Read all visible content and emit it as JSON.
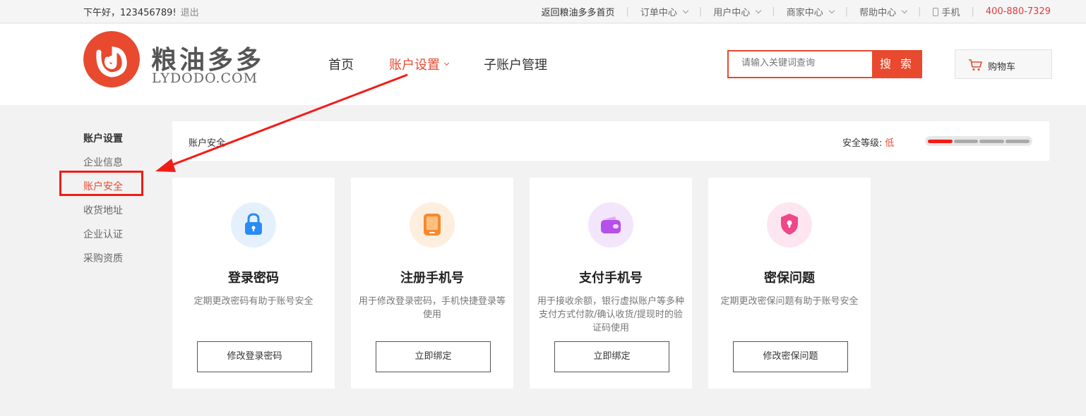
{
  "topbar": {
    "greeting": "下午好，123456789!",
    "logout": "退出",
    "links": [
      {
        "label": "返回粮油多多首页"
      },
      {
        "label": "订单中心"
      },
      {
        "label": "用户中心"
      },
      {
        "label": "商家中心"
      },
      {
        "label": "帮助中心"
      },
      {
        "label": "手机"
      }
    ],
    "hotline": "400-880-7329"
  },
  "header": {
    "logo_cn": "粮油多多",
    "logo_en": "LYDODO.COM",
    "nav": [
      {
        "label": "首页"
      },
      {
        "label": "账户设置"
      },
      {
        "label": "子账户管理"
      }
    ],
    "search_placeholder": "请输入关键词查询",
    "search_button": "搜 索",
    "cart_label": "购物车"
  },
  "sidebar": {
    "title": "账户设置",
    "items": [
      "企业信息",
      "账户安全",
      "收货地址",
      "企业认证",
      "采购资质"
    ]
  },
  "main": {
    "breadcrumb": "账户安全",
    "security_level_label": "安全等级:",
    "security_level_value": "低",
    "security_level_segments_filled": 1,
    "security_level_segments_total": 4,
    "cards": [
      {
        "title": "登录密码",
        "desc": "定期更改密码有助于账号安全",
        "button": "修改登录密码",
        "icon": "lock-icon"
      },
      {
        "title": "注册手机号",
        "desc": "用于修改登录密码，手机快捷登录等使用",
        "button": "立即绑定",
        "icon": "tablet-icon"
      },
      {
        "title": "支付手机号",
        "desc": "用于接收余额，银行虚拟账户等多种支付方式付款/确认收货/提现时的验证码使用",
        "button": "立即绑定",
        "icon": "wallet-icon"
      },
      {
        "title": "密保问题",
        "desc": "定期更改密保问题有助于账号安全",
        "button": "修改密保问题",
        "icon": "shield-icon"
      }
    ]
  },
  "colors": {
    "accent": "#e8492f",
    "annotation_red": "#f21c17"
  }
}
